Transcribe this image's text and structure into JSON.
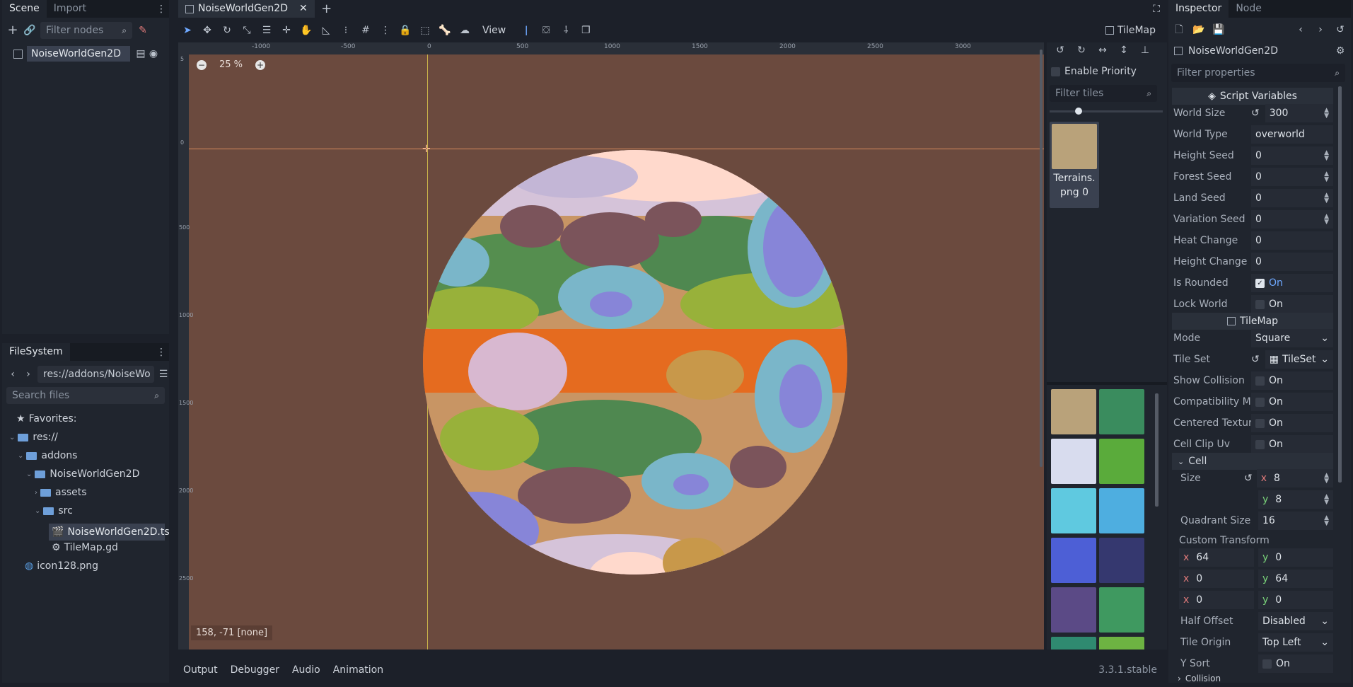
{
  "scene_dock": {
    "tabs": [
      "Scene",
      "Import"
    ],
    "filter_placeholder": "Filter nodes",
    "root_node": "NoiseWorldGen2D"
  },
  "filesystem": {
    "tab": "FileSystem",
    "path": "res://addons/NoiseWo",
    "search_placeholder": "Search files",
    "items": [
      {
        "label": "Favorites:",
        "icon": "star-icon"
      },
      {
        "label": "res://",
        "icon": "folder-icon"
      },
      {
        "label": "addons",
        "icon": "folder-icon"
      },
      {
        "label": "NoiseWorldGen2D",
        "icon": "folder-icon"
      },
      {
        "label": "assets",
        "icon": "folder-icon"
      },
      {
        "label": "src",
        "icon": "folder-icon"
      },
      {
        "label": "NoiseWorldGen2D.ts",
        "icon": "scene-file-icon"
      },
      {
        "label": "TileMap.gd",
        "icon": "gear-icon"
      },
      {
        "label": "icon128.png",
        "icon": "image-icon"
      }
    ]
  },
  "editor": {
    "scene_tab": "NoiseWorldGen2D",
    "view_menu": "View",
    "tilemap_label": "TileMap",
    "zoom": "25 %",
    "ruler_marks": [
      "-1000",
      "-500",
      "0",
      "500",
      "1000",
      "1500",
      "2000",
      "2500",
      "3000"
    ],
    "vruler_marks": [
      "5",
      "0",
      "500",
      "1000",
      "1500",
      "2000",
      "2500"
    ],
    "cursor_readout": "158, -71 [none]",
    "bg_color": "#6b4a3e"
  },
  "tile_palette": {
    "enable_priority": "Enable Priority",
    "filter_placeholder": "Filter tiles",
    "selected_tile_label_1": "Terrains.",
    "selected_tile_label_2": "png 0"
  },
  "bottom_bar": {
    "tabs": [
      "Output",
      "Debugger",
      "Audio",
      "Animation"
    ],
    "version": "3.3.1.stable"
  },
  "inspector": {
    "tabs": [
      "Inspector",
      "Node"
    ],
    "object": "NoiseWorldGen2D",
    "filter_placeholder": "Filter properties",
    "script_section": "Script Variables",
    "world_size_label": "World Size",
    "world_size": "300",
    "world_type_label": "World Type",
    "world_type": "overworld",
    "height_seed_label": "Height Seed",
    "height_seed": "0",
    "forest_seed_label": "Forest Seed",
    "forest_seed": "0",
    "land_seed_label": "Land Seed",
    "land_seed": "0",
    "variation_seed_label": "Variation Seed",
    "variation_seed": "0",
    "heat_change_label": "Heat Change",
    "heat_change": "0",
    "height_change_label": "Height Change",
    "height_change": "0",
    "is_rounded_label": "Is Rounded",
    "is_rounded": "On",
    "lock_world_label": "Lock World",
    "lock_world": "On",
    "tilemap_section": "TileMap",
    "mode_label": "Mode",
    "mode": "Square",
    "tile_set_label": "Tile Set",
    "tile_set": "TileSet",
    "show_collision_label": "Show Collision",
    "show_collision": "On",
    "compat_label": "Compatibility M",
    "compat": "On",
    "centered_label": "Centered Textur",
    "centered": "On",
    "clip_uv_label": "Cell Clip Uv",
    "clip_uv": "On",
    "cell_section": "Cell",
    "size_label": "Size",
    "size_x": "8",
    "size_y": "8",
    "quadrant_label": "Quadrant Size",
    "quadrant": "16",
    "custom_transform_label": "Custom Transform",
    "ct": [
      "64",
      "0",
      "0",
      "64",
      "0",
      "0"
    ],
    "half_offset_label": "Half Offset",
    "half_offset": "Disabled",
    "tile_origin_label": "Tile Origin",
    "tile_origin": "Top Left",
    "y_sort_label": "Y Sort",
    "y_sort": "On",
    "collision_label": "Collision"
  }
}
